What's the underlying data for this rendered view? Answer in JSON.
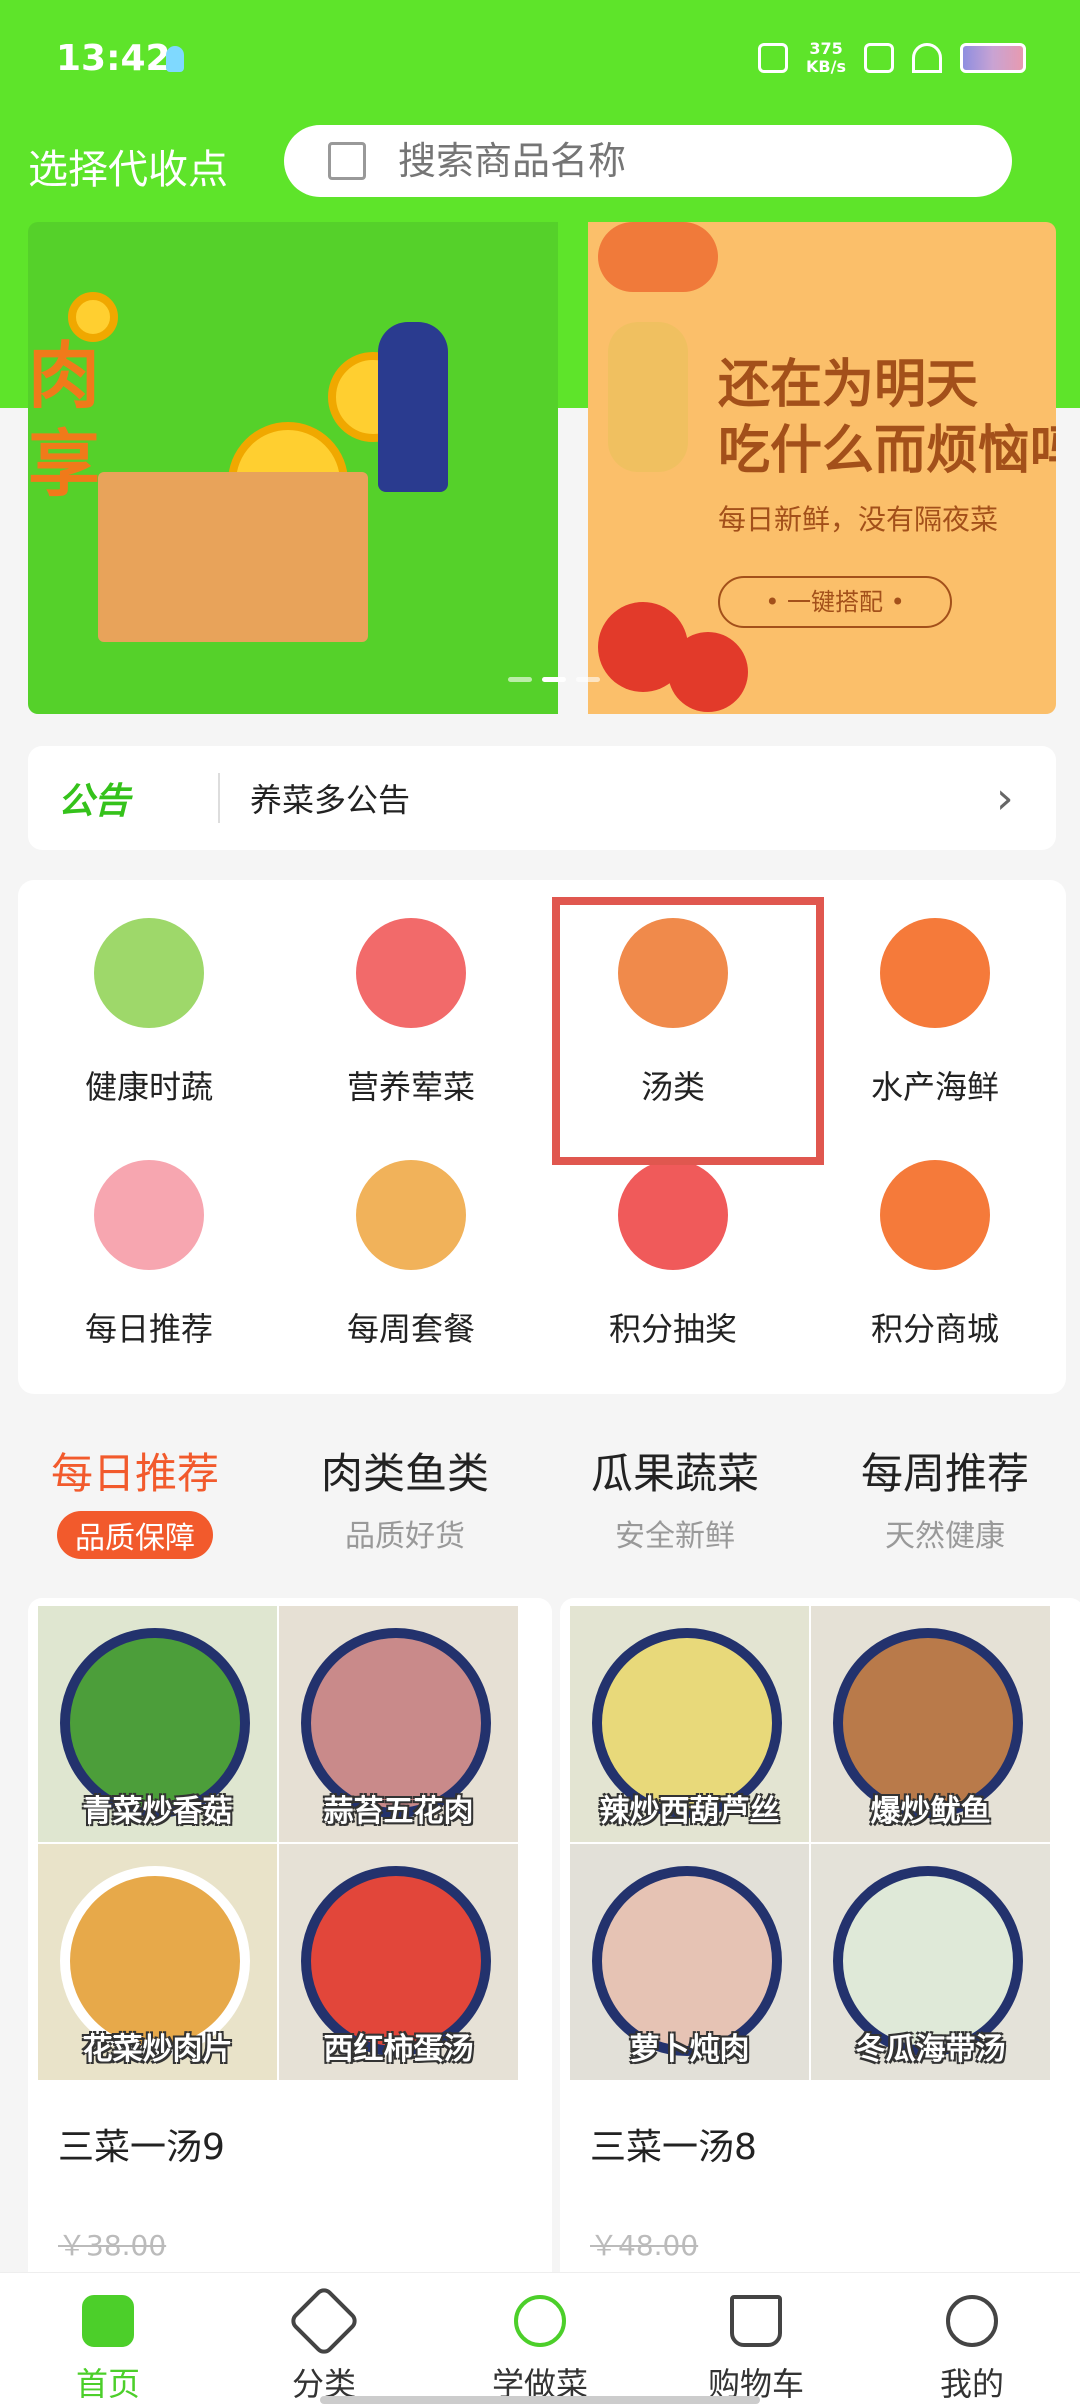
{
  "status_bar": {
    "time": "13:42",
    "net_speed_value": "375",
    "net_speed_unit": "KB/s"
  },
  "header": {
    "pickup_label": "选择代收点",
    "search_placeholder": "搜索商品名称"
  },
  "banner": {
    "slide1_text": "肉\n享",
    "slide2_title": "还在为明天\n吃什么而烦恼吗",
    "slide2_subtitle": "每日新鲜，没有隔夜菜",
    "slide2_button": "• 一键搭配 •"
  },
  "notice": {
    "logo_text": "公告",
    "text": "养菜多公告"
  },
  "categories": [
    {
      "label": "健康时蔬",
      "icon": "vegetable-icon",
      "color": "#9ed86a"
    },
    {
      "label": "营养荤菜",
      "icon": "meat-icon",
      "color": "#f26a6a"
    },
    {
      "label": "汤类",
      "icon": "soup-icon",
      "color": "#f08a4b"
    },
    {
      "label": "水产海鲜",
      "icon": "shrimp-icon",
      "color": "#f57a3a"
    },
    {
      "label": "每日推荐",
      "icon": "calendar-icon",
      "color": "#f7a6b0"
    },
    {
      "label": "每周套餐",
      "icon": "platter-icon",
      "color": "#f1b25a"
    },
    {
      "label": "积分抽奖",
      "icon": "coupon-icon",
      "color": "#f05a5a"
    },
    {
      "label": "积分商城",
      "icon": "shop-icon",
      "color": "#f57a3a"
    }
  ],
  "tabs": [
    {
      "title": "每日推荐",
      "subtitle": "品质保障"
    },
    {
      "title": "肉类鱼类",
      "subtitle": "品质好货"
    },
    {
      "title": "瓜果蔬菜",
      "subtitle": "安全新鲜"
    },
    {
      "title": "每周推荐",
      "subtitle": "天然健康"
    }
  ],
  "products": [
    {
      "name": "三菜一汤9",
      "price": "￥38.00",
      "dishes": [
        "青菜炒香菇",
        "蒜苔五花肉",
        "花菜炒肉片",
        "西红柿蛋汤"
      ]
    },
    {
      "name": "三菜一汤8",
      "price": "￥48.00",
      "dishes": [
        "辣炒西葫芦丝",
        "爆炒鱿鱼",
        "萝卜炖肉",
        "冬瓜海带汤"
      ]
    }
  ],
  "bottom_nav": [
    {
      "label": "首页",
      "icon": "home-icon"
    },
    {
      "label": "分类",
      "icon": "category-icon"
    },
    {
      "label": "学做菜",
      "icon": "cook-icon"
    },
    {
      "label": "购物车",
      "icon": "cart-icon"
    },
    {
      "label": "我的",
      "icon": "profile-icon"
    }
  ],
  "colors": {
    "brand_green": "#5ee42a",
    "accent_orange": "#f25a2c",
    "highlight_red": "#e0574f"
  }
}
